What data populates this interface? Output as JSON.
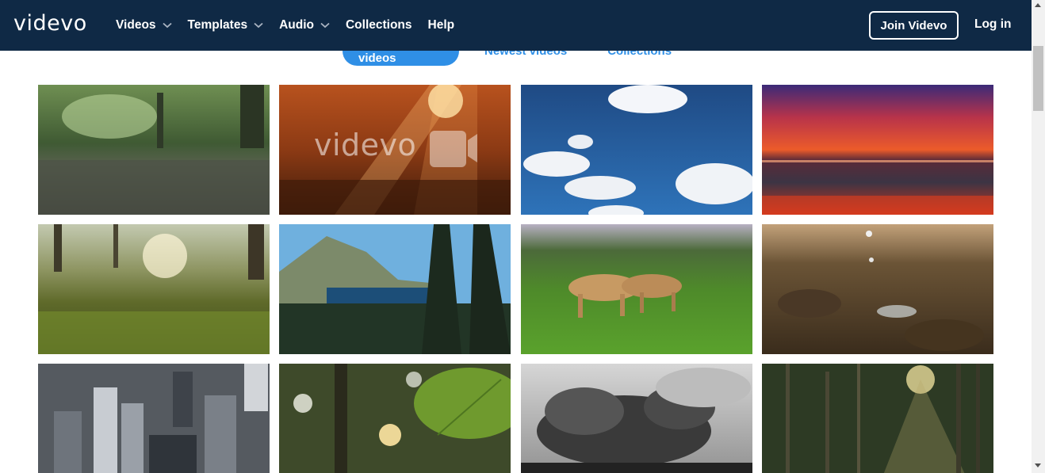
{
  "header": {
    "logo": "videvo",
    "nav": [
      {
        "label": "Videos",
        "dropdown": true
      },
      {
        "label": "Templates",
        "dropdown": true
      },
      {
        "label": "Audio",
        "dropdown": true
      },
      {
        "label": "Collections",
        "dropdown": false
      },
      {
        "label": "Help",
        "dropdown": false
      }
    ],
    "join_label": "Join Videvo",
    "login_label": "Log in"
  },
  "tabs": {
    "popular": "Popular videos",
    "newest": "Newest videos",
    "collections": "Collections"
  },
  "grid": {
    "watermark": "videvo",
    "thumbnails": [
      "rain-forest-puddle",
      "sunrays-forest-aerial",
      "blue-sky-clouds",
      "red-sunset-ocean",
      "forest-grass-sunlight",
      "mountain-lake-pines",
      "lionesses-walking",
      "water-drops-soil",
      "city-aerial-skyscrapers",
      "leaf-bokeh",
      "storm-clouds-bw",
      "pine-forest-rays"
    ]
  },
  "colors": {
    "header_bg": "#0f2945",
    "accent": "#2f8fe6"
  }
}
